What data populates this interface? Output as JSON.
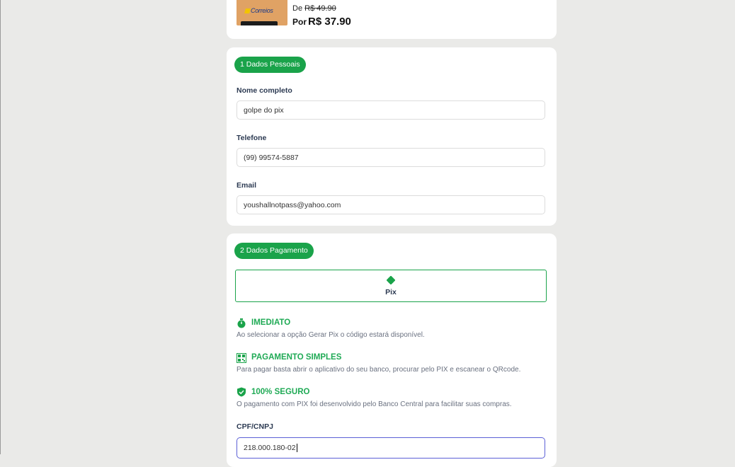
{
  "product": {
    "brand_logo": "Correios",
    "old_price_prefix": "De",
    "old_price": "R$ 49.90",
    "new_price_prefix": "Por",
    "new_price": "R$ 37.90"
  },
  "personal": {
    "step_label": "1 Dados Pessoais",
    "name_label": "Nome completo",
    "name_value": "golpe do pix",
    "phone_label": "Telefone",
    "phone_value": "(99) 99574-5887",
    "email_label": "Email",
    "email_value": "youshallnotpass@yahoo.com"
  },
  "payment": {
    "step_label": "2 Dados Pagamento",
    "method_label": "Pix",
    "features": [
      {
        "icon": "stopwatch-icon",
        "title": "IMEDIATO",
        "text": "Ao selecionar a opção Gerar Pix o código estará disponível."
      },
      {
        "icon": "qrcode-icon",
        "title": "PAGAMENTO SIMPLES",
        "text": "Para pagar basta abrir o aplicativo do seu banco, procurar pelo PIX e escanear o QRcode."
      },
      {
        "icon": "shield-check-icon",
        "title": "100% SEGURO",
        "text": "O pagamento com PIX foi desenvolvido pelo Banco Central para facilitar suas compras."
      }
    ],
    "cpf_label": "CPF/CNPJ",
    "cpf_value": "218.000.180-02"
  },
  "colors": {
    "accent_green": "#1aa34a",
    "focus_border": "#5b5fd6",
    "background": "#eaeae8"
  }
}
